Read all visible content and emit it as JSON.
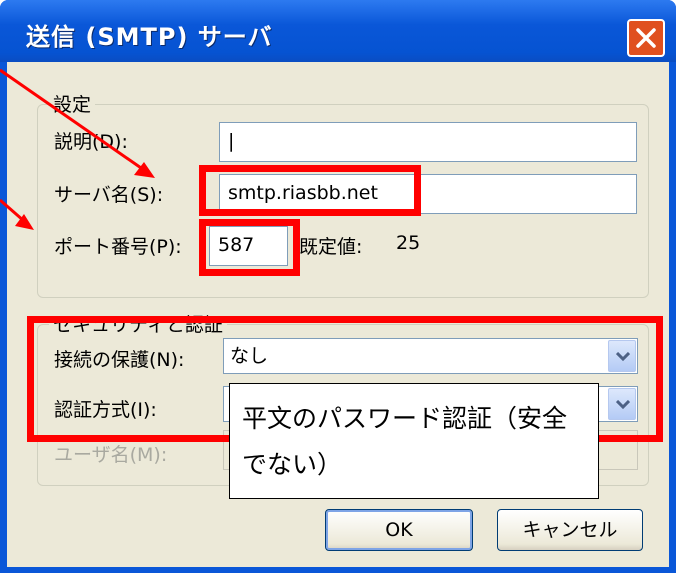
{
  "window": {
    "title": "送信 (SMTP) サーバ"
  },
  "settings_group": {
    "label": "設定",
    "description_label": "説明(D):",
    "description_value": "|",
    "server_label": "サーバ名(S):",
    "server_value": "smtp.riasbb.net",
    "port_label": "ポート番号(P):",
    "port_value": "587",
    "default_label": "既定値:",
    "default_value": "25"
  },
  "security_group": {
    "label": "セキュリティと認証",
    "connection_label": "接続の保護(N):",
    "connection_value": "なし",
    "auth_label": "認証方式(I):",
    "user_label": "ユーザ名(M):"
  },
  "callout": {
    "text": "平文のパスワード認証（安全でない）"
  },
  "buttons": {
    "ok": "OK",
    "cancel": "キャンセル"
  },
  "colors": {
    "annotation": "#ff0000",
    "titlebar": "#0a57d8",
    "dialog_bg": "#ece9d8"
  },
  "icons": {
    "close": "close-icon",
    "dropdown": "chevron-down-icon"
  }
}
